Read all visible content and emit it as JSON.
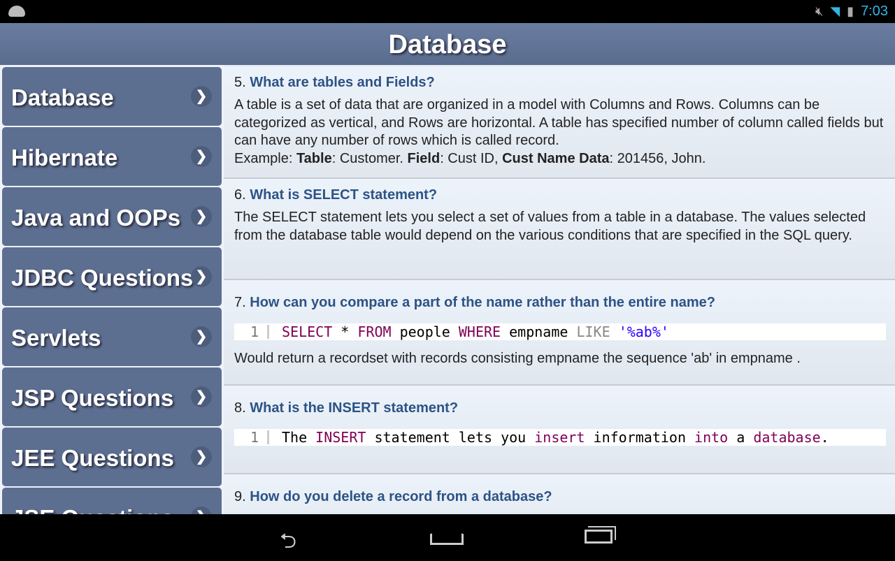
{
  "status_bar": {
    "time": "7:03",
    "icons": [
      "android-icon",
      "mute-icon",
      "wifi-icon",
      "battery-charging-icon"
    ]
  },
  "header": {
    "title": "Database"
  },
  "sidebar": {
    "items": [
      {
        "label": "Database"
      },
      {
        "label": "Hibernate"
      },
      {
        "label": "Java and OOPs"
      },
      {
        "label": "JDBC Questions"
      },
      {
        "label": "Servlets"
      },
      {
        "label": "JSP Questions"
      },
      {
        "label": "JEE Questions"
      },
      {
        "label": "JSE Questions"
      }
    ]
  },
  "questions": [
    {
      "num": "5.",
      "title": "What are tables and Fields?",
      "answer": "A table is a set of data that are organized in a model with Columns and Rows. Columns can be categorized as vertical, and Rows are horizontal. A table has specified number of column called fields but can have any number of rows which is called record.",
      "example": {
        "prefix": "Example: ",
        "k1": "Table",
        "v1": ": Customer. ",
        "k2": "Field",
        "v2": ": Cust ID, ",
        "k3": "Cust Name Data",
        "v3": ": 201456, John."
      }
    },
    {
      "num": "6.",
      "title": "What is SELECT statement?",
      "answer": "The SELECT statement lets you select a set of values from a table in a database. The values selected from the database table would depend on the various conditions that are specified in the SQL query."
    },
    {
      "num": "7.",
      "title": "How can you compare a part of the name rather than the entire name?",
      "code": {
        "line": "1",
        "t1": "SELECT",
        "t2": " * ",
        "t3": "FROM",
        "t4": " people ",
        "t5": "WHERE",
        "t6": " empname ",
        "t7": "LIKE",
        "t8": " ",
        "t9": "'%ab%'"
      },
      "answer": "Would return a recordset with records consisting empname the sequence 'ab' in empname ."
    },
    {
      "num": "8.",
      "title": "What is the INSERT statement?",
      "code": {
        "line": "1",
        "t1": "The ",
        "t2": "INSERT",
        "t3": " statement lets you ",
        "t4": "insert",
        "t5": " information ",
        "t6": "into",
        "t7": " a ",
        "t8": "database",
        "t9": "."
      }
    },
    {
      "num": "9.",
      "title": "How do you delete a record from a database?"
    }
  ],
  "colors": {
    "header": "#5f7194",
    "sidebar_item": "#5d6f91",
    "question_title": "#2c5385",
    "keyword": "#7f0055",
    "string": "#2a00ff",
    "clock": "#33b5e5"
  }
}
